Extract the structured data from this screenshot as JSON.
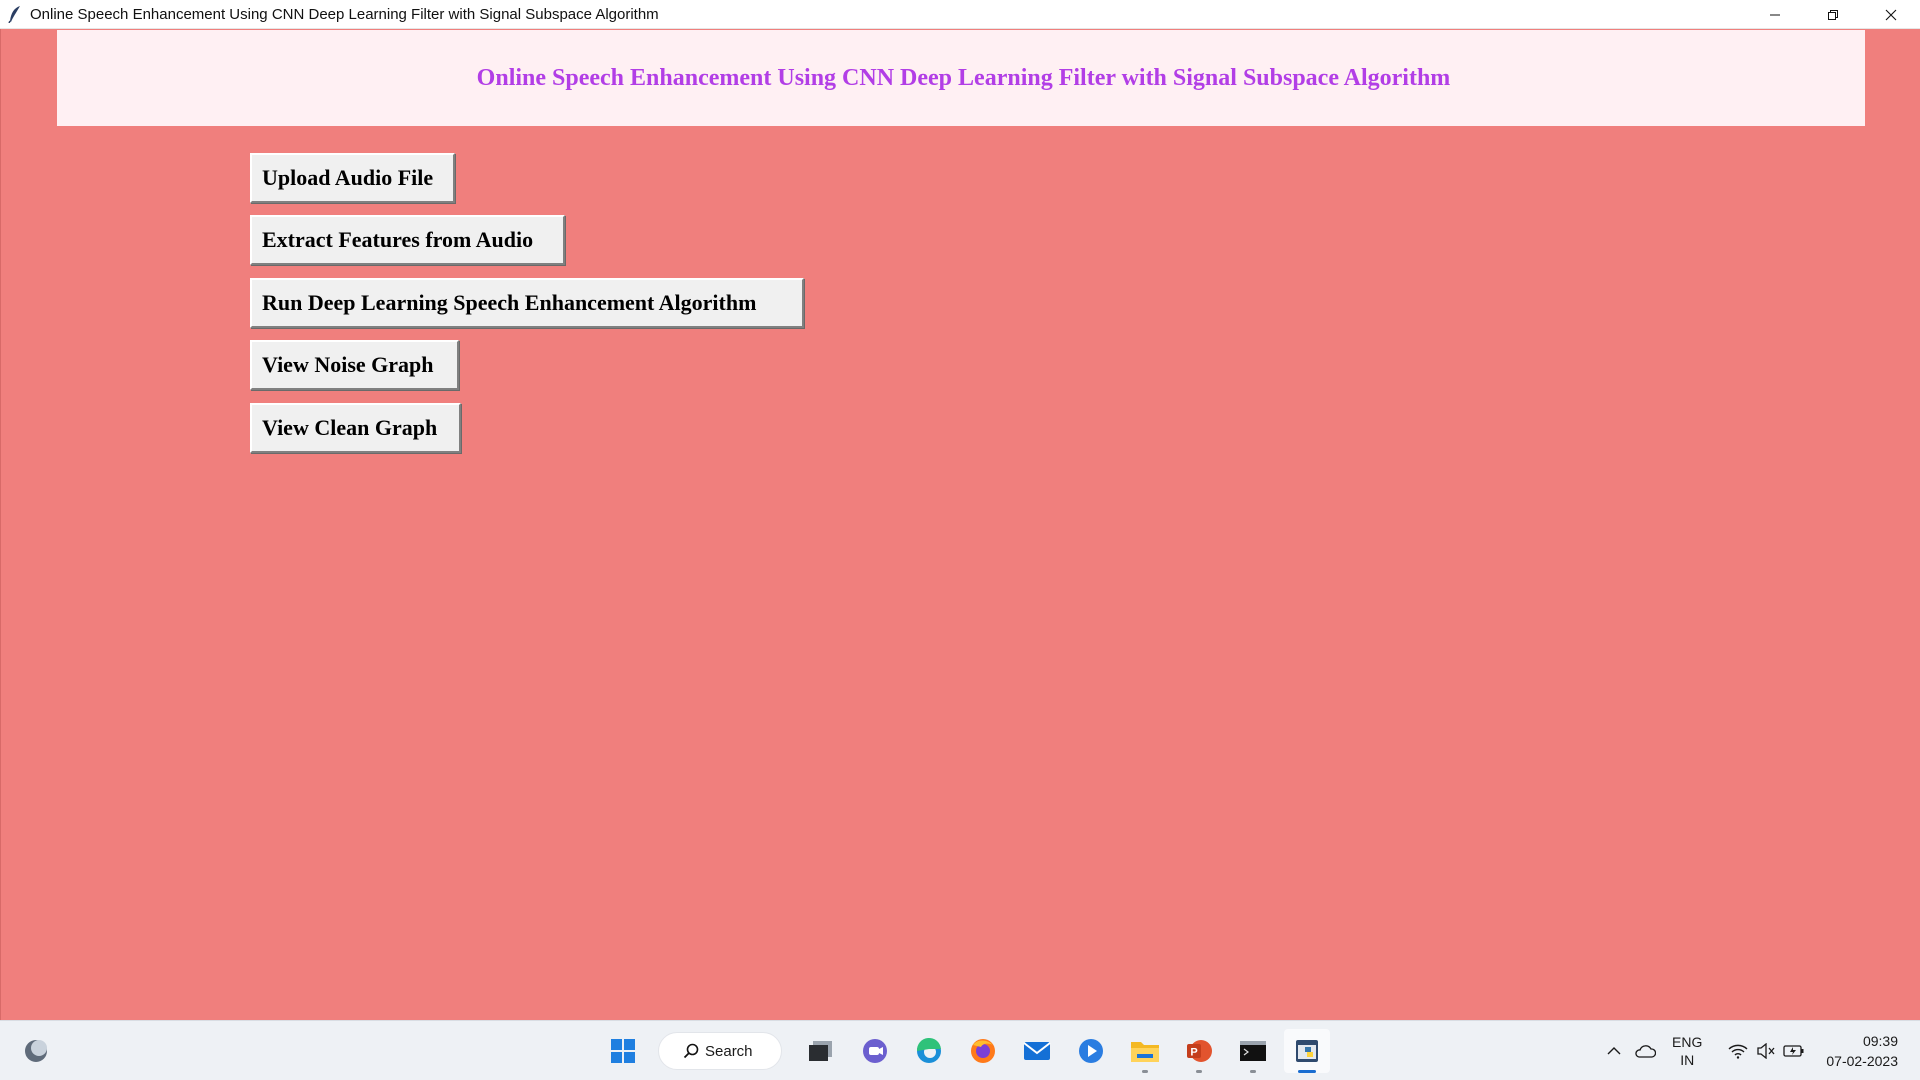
{
  "window": {
    "title": "Online Speech Enhancement Using CNN Deep Learning Filter with Signal Subspace Algorithm",
    "header_title": "Online Speech Enhancement Using CNN Deep Learning Filter with Signal Subspace Algorithm"
  },
  "buttons": [
    {
      "label": "Upload Audio File"
    },
    {
      "label": "Extract Features from Audio"
    },
    {
      "label": "Run Deep Learning Speech Enhancement Algorithm"
    },
    {
      "label": "View Noise Graph"
    },
    {
      "label": "View Clean Graph"
    }
  ],
  "colors": {
    "background": "#f07f7d",
    "header_panel": "#fff0f3",
    "header_text": "#b23ee6",
    "button_face": "#f0f0f0"
  },
  "taskbar": {
    "search_label": "Search",
    "pinned_icons": [
      "windows-start-icon",
      "task-view-icon",
      "teams-chat-icon",
      "edge-icon",
      "firefox-icon",
      "mail-icon",
      "media-player-icon",
      "file-explorer-icon",
      "powerpoint-icon",
      "terminal-icon",
      "python-app-icon"
    ],
    "language_top": "ENG",
    "language_bottom": "IN",
    "time": "09:39",
    "date": "07-02-2023"
  }
}
